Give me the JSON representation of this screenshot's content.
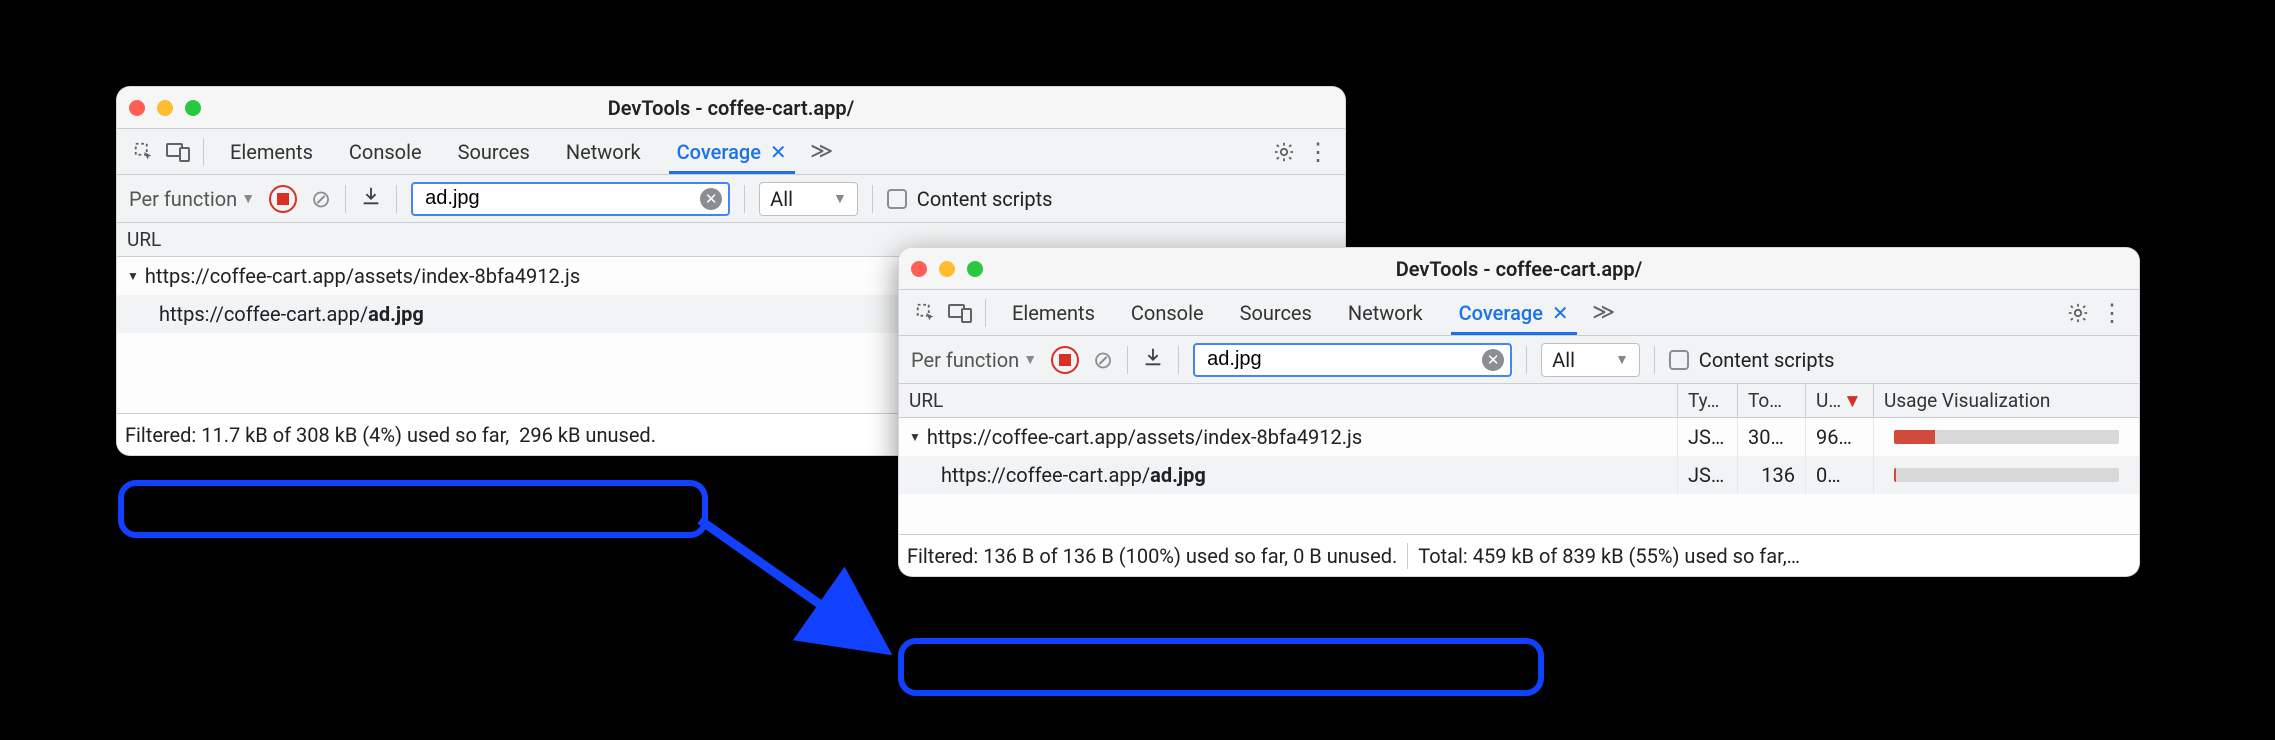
{
  "window1": {
    "title": "DevTools - coffee-cart.app/",
    "tabs": [
      "Elements",
      "Console",
      "Sources",
      "Network"
    ],
    "activeTab": "Coverage",
    "toolbar": {
      "granularity": "Per function",
      "searchValue": "ad.jpg",
      "filter": "All",
      "contentScripts": "Content scripts"
    },
    "columns": {
      "url": "URL"
    },
    "rows": [
      {
        "url": "https://coffee-cart.app/assets/index-8bfa4912.js",
        "expandable": true
      },
      {
        "url_prefix": "https://coffee-cart.app/",
        "url_bold": "ad.jpg",
        "indent": true
      }
    ],
    "footer": {
      "filtered": "Filtered: 11.7 kB of 308 kB (4%) used so far,",
      "total": "296 kB unused."
    }
  },
  "window2": {
    "title": "DevTools - coffee-cart.app/",
    "tabs": [
      "Elements",
      "Console",
      "Sources",
      "Network"
    ],
    "activeTab": "Coverage",
    "toolbar": {
      "granularity": "Per function",
      "searchValue": "ad.jpg",
      "filter": "All",
      "contentScripts": "Content scripts"
    },
    "columns": {
      "url": "URL",
      "type": "Ty…",
      "total": "To…",
      "unused": "U…",
      "usage": "Usage Visualization"
    },
    "rows": [
      {
        "url": "https://coffee-cart.app/assets/index-8bfa4912.js",
        "expandable": true,
        "type": "JS…",
        "total": "30…",
        "unused": "96…",
        "usagePct": 18
      },
      {
        "url_prefix": "https://coffee-cart.app/",
        "url_bold": "ad.jpg",
        "indent": true,
        "type": "JS…",
        "total": "136",
        "unused": "0…",
        "usagePct": 1
      }
    ],
    "footer": {
      "filtered": "Filtered: 136 B of 136 B (100%) used so far, 0 B unused.",
      "total": "Total: 459 kB of 839 kB (55%) used so far,…"
    }
  }
}
